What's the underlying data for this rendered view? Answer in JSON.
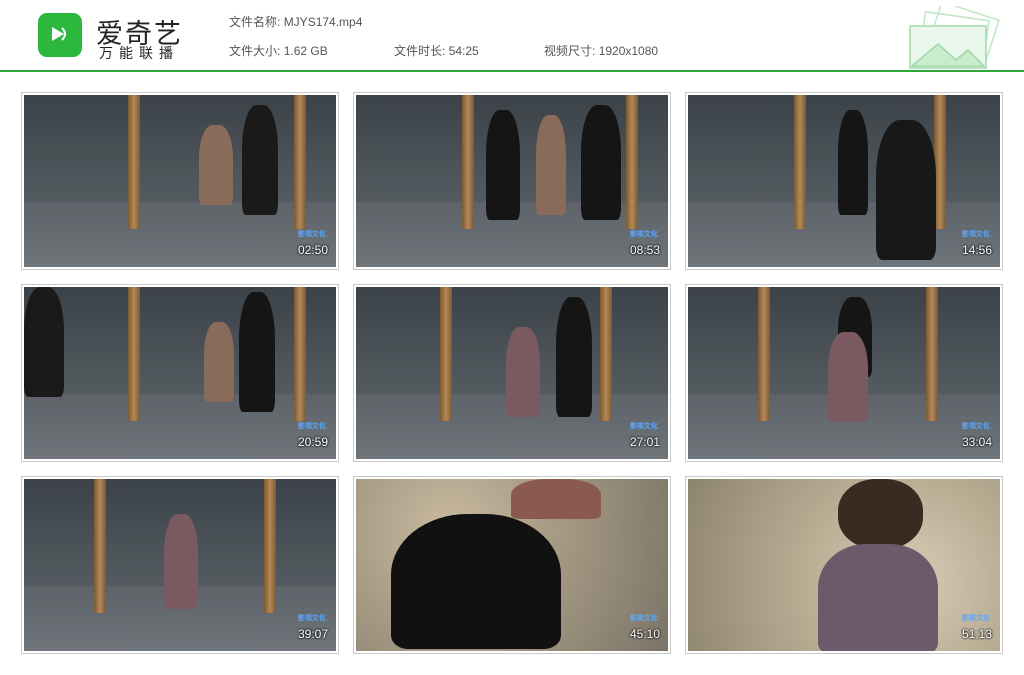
{
  "brand": {
    "name": "爱奇艺",
    "tagline": "万能联播",
    "color": "#2cb83f"
  },
  "meta": {
    "filename_label": "文件名称:",
    "filename_value": "MJYS174.mp4",
    "size_label": "文件大小:",
    "size_value": "1.62 GB",
    "duration_label": "文件时长:",
    "duration_value": "54:25",
    "resolution_label": "视频尺寸:",
    "resolution_value": "1920x1080"
  },
  "thumbnails": [
    {
      "time": "02:50",
      "scene": "indoor",
      "watermark": "影视文化"
    },
    {
      "time": "08:53",
      "scene": "indoor",
      "watermark": "影视文化"
    },
    {
      "time": "14:56",
      "scene": "indoor",
      "watermark": "影视文化"
    },
    {
      "time": "20:59",
      "scene": "indoor",
      "watermark": "影视文化"
    },
    {
      "time": "27:01",
      "scene": "indoor",
      "watermark": "影视文化"
    },
    {
      "time": "33:04",
      "scene": "indoor",
      "watermark": "影视文化"
    },
    {
      "time": "39:07",
      "scene": "indoor",
      "watermark": "影视文化"
    },
    {
      "time": "45:10",
      "scene": "outdoor",
      "watermark": "影视文化"
    },
    {
      "time": "51:13",
      "scene": "outdoor",
      "watermark": "影视文化"
    }
  ],
  "colors": {
    "accent": "#2da838"
  }
}
